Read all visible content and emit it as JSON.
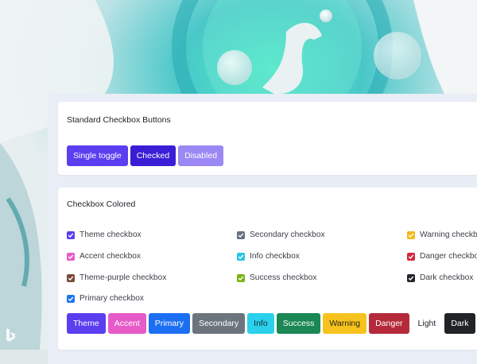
{
  "standard": {
    "title": "Standard Checkbox Buttons",
    "buttons": [
      {
        "label": "Single toggle",
        "color": "#5b3ef0"
      },
      {
        "label": "Checked",
        "color": "#3a1ed6"
      },
      {
        "label": "Disabled",
        "color": "#9b88f4"
      }
    ]
  },
  "colored": {
    "title": "Checkbox Colored",
    "checkboxes": [
      {
        "label": "Theme checkbox",
        "color": "#5b3ef0"
      },
      {
        "label": "Accent checkbox",
        "color": "#e75bc8"
      },
      {
        "label": "Theme-purple checkbox",
        "color": "#7a4a38"
      },
      {
        "label": "Primary checkbox",
        "color": "#1c75f0"
      },
      {
        "label": "Secondary checkbox",
        "color": "#687182"
      },
      {
        "label": "Info checkbox",
        "color": "#2dc4e6"
      },
      {
        "label": "Success checkbox",
        "color": "#7bb314"
      },
      {
        "label": "Warning checkbox",
        "color": "#f5b71c"
      },
      {
        "label": "Danger checkbox",
        "color": "#d3283d"
      },
      {
        "label": "Dark checkbox",
        "color": "#22252b"
      }
    ],
    "buttons": [
      {
        "label": "Theme",
        "color": "#5b3ef0",
        "text": "#ffffff"
      },
      {
        "label": "Accent",
        "color": "#e75bc8",
        "text": "#ffffff"
      },
      {
        "label": "Primary",
        "color": "#1c6ff2",
        "text": "#ffffff"
      },
      {
        "label": "Secondary",
        "color": "#6c757d",
        "text": "#ffffff"
      },
      {
        "label": "Info",
        "color": "#2ad0ec",
        "text": "#1d2b33"
      },
      {
        "label": "Success",
        "color": "#1a8754",
        "text": "#ffffff"
      },
      {
        "label": "Warning",
        "color": "#f6c31e",
        "text": "#2a2410"
      },
      {
        "label": "Danger",
        "color": "#b52a3a",
        "text": "#ffffff"
      },
      {
        "label": "Light",
        "color": "#ffffff",
        "text": "#23262c"
      },
      {
        "label": "Dark",
        "color": "#202327",
        "text": "#ffffff"
      }
    ]
  }
}
